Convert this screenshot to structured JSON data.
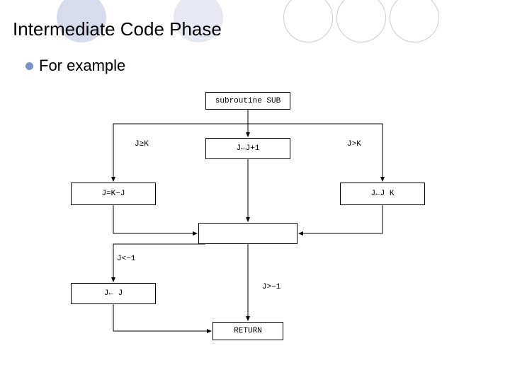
{
  "title": "Intermediate Code Phase",
  "bullet": "For example",
  "nodes": {
    "n0": "subroutine SUB",
    "n1": "J←J+1",
    "n2": "J=K−J",
    "n3": "J←J K",
    "n4": "",
    "n5": "J← J",
    "n6": "RETURN"
  },
  "edges": {
    "e_jgek": "J≥K",
    "e_jgtk": "J>K",
    "e_jltm1": "J<−1",
    "e_jgtm1": "J>−1"
  }
}
